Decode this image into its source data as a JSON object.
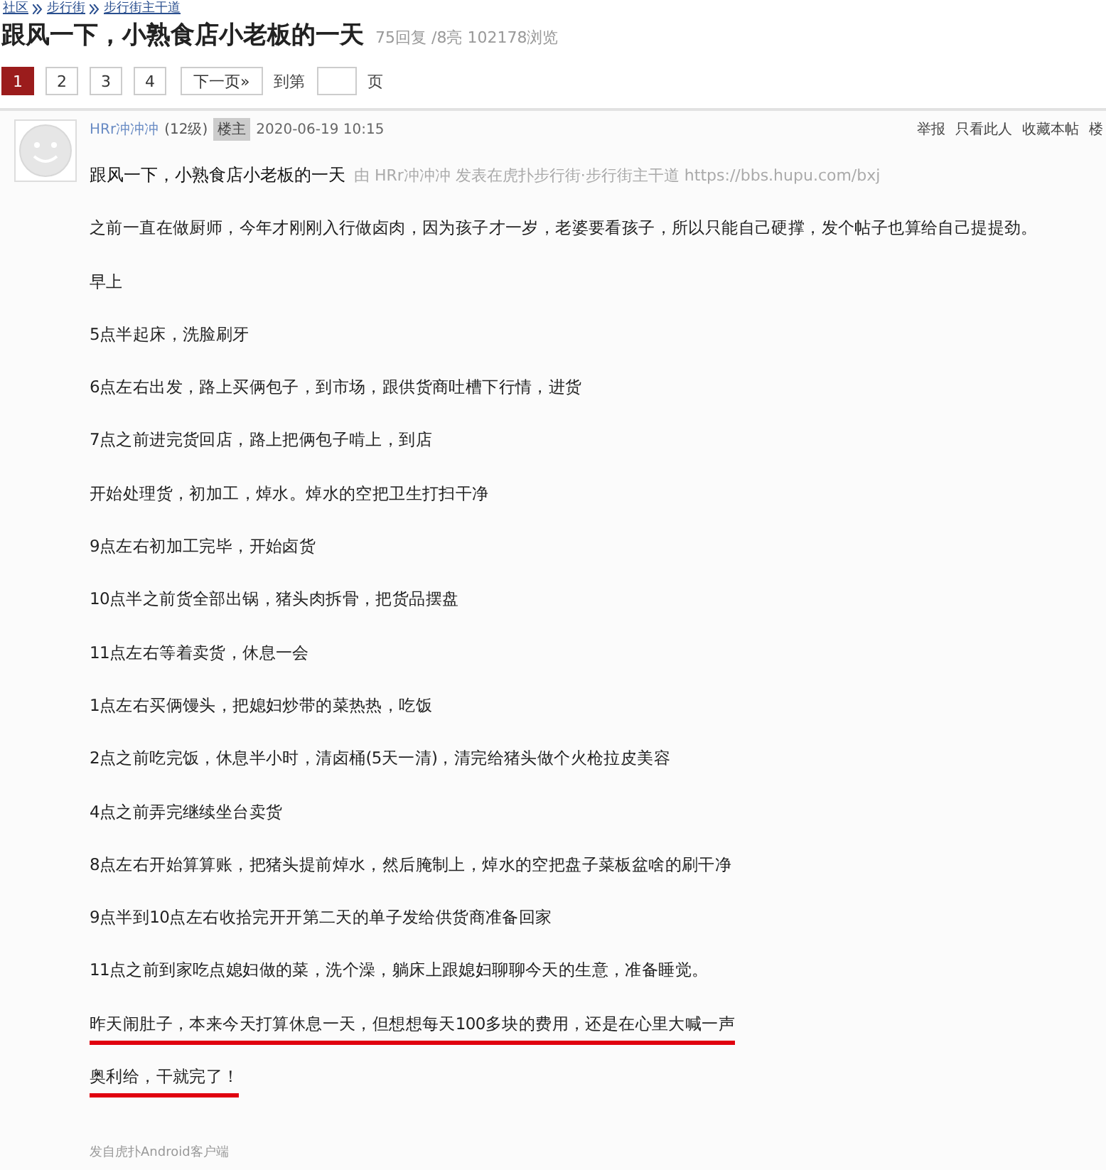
{
  "breadcrumb": [
    "社区",
    "步行街",
    "步行街主干道"
  ],
  "title": "跟风一下，小熟食店小老板的一天",
  "stats": "75回复 /8亮  102178浏览",
  "pagination": {
    "pages": [
      {
        "label": "1",
        "selected": true
      },
      {
        "label": "2",
        "selected": false
      },
      {
        "label": "3",
        "selected": false
      },
      {
        "label": "4",
        "selected": false
      }
    ],
    "next": "下一页»",
    "goto_label": "到第",
    "goto_suffix": "页"
  },
  "post": {
    "author": "HRr冲冲冲",
    "level": "(12级)",
    "badge": "楼主",
    "time": "2020-06-19 10:15",
    "actions": [
      "举报",
      "只看此人",
      "收藏本帖",
      "楼"
    ],
    "heading": "跟风一下，小熟食店小老板的一天",
    "source": "由  HRr冲冲冲 发表在虎扑步行街·步行街主干道 https://bbs.hupu.com/bxj",
    "lines": [
      {
        "text": "之前一直在做厨师，今年才刚刚入行做卤肉，因为孩子才一岁，老婆要看孩子，所以只能自己硬撑，发个帖子也算给自己提提劲。",
        "underlined": false
      },
      {
        "text": "早上",
        "underlined": false
      },
      {
        "text": "5点半起床，洗脸刷牙",
        "underlined": false
      },
      {
        "text": "6点左右出发，路上买俩包子，到市场，跟供货商吐槽下行情，进货",
        "underlined": false
      },
      {
        "text": "7点之前进完货回店，路上把俩包子啃上，到店",
        "underlined": false
      },
      {
        "text": "开始处理货，初加工，焯水。焯水的空把卫生打扫干净",
        "underlined": false
      },
      {
        "text": "9点左右初加工完毕，开始卤货",
        "underlined": false
      },
      {
        "text": "10点半之前货全部出锅，猪头肉拆骨，把货品摆盘",
        "underlined": false
      },
      {
        "text": "11点左右等着卖货，休息一会",
        "underlined": false
      },
      {
        "text": "1点左右买俩馒头，把媳妇炒带的菜热热，吃饭",
        "underlined": false
      },
      {
        "text": "2点之前吃完饭，休息半小时，清卤桶(5天一清)，清完给猪头做个火枪拉皮美容",
        "underlined": false
      },
      {
        "text": "4点之前弄完继续坐台卖货",
        "underlined": false
      },
      {
        "text": "8点左右开始算算账，把猪头提前焯水，然后腌制上，焯水的空把盘子菜板盆啥的刷干净",
        "underlined": false
      },
      {
        "text": "9点半到10点左右收拾完开开第二天的单子发给供货商准备回家",
        "underlined": false
      },
      {
        "text": "11点之前到家吃点媳妇做的菜，洗个澡，躺床上跟媳妇聊聊今天的生意，准备睡觉。",
        "underlined": false
      },
      {
        "text": "昨天闹肚子，本来今天打算休息一天，但想想每天100多块的费用，还是在心里大喊一声",
        "underlined": true
      },
      {
        "text": "奥利给，干就完了！",
        "underlined": true
      }
    ],
    "footer": "发自虎扑Android客户端"
  }
}
